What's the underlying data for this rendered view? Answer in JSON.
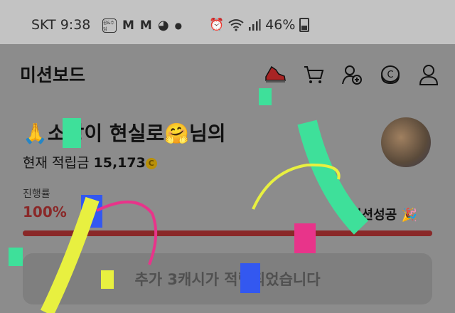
{
  "status_bar": {
    "carrier": "SKT",
    "time": "9:38",
    "notif_box_label": "꿈&수업",
    "m1": "M",
    "m2": "M",
    "battery": "46%"
  },
  "app": {
    "title": "미션보드",
    "icons": [
      "shoe-icon",
      "cart-icon",
      "add-user-icon",
      "coin-icon",
      "profile-icon"
    ]
  },
  "mission": {
    "title": "🙏소망이 현실로🤗님의",
    "balance_label": "현재 적립금",
    "balance_value": "15,173",
    "coin_symbol": "C"
  },
  "progress": {
    "label": "진행률",
    "value_text": "100%",
    "fraction": 1.0,
    "success_text": "미션성공 🎉"
  },
  "notice": {
    "text": "추가 3캐시가 적립되었습니다"
  },
  "colors": {
    "accent_red": "#8a2828",
    "coin": "#b8900a"
  }
}
